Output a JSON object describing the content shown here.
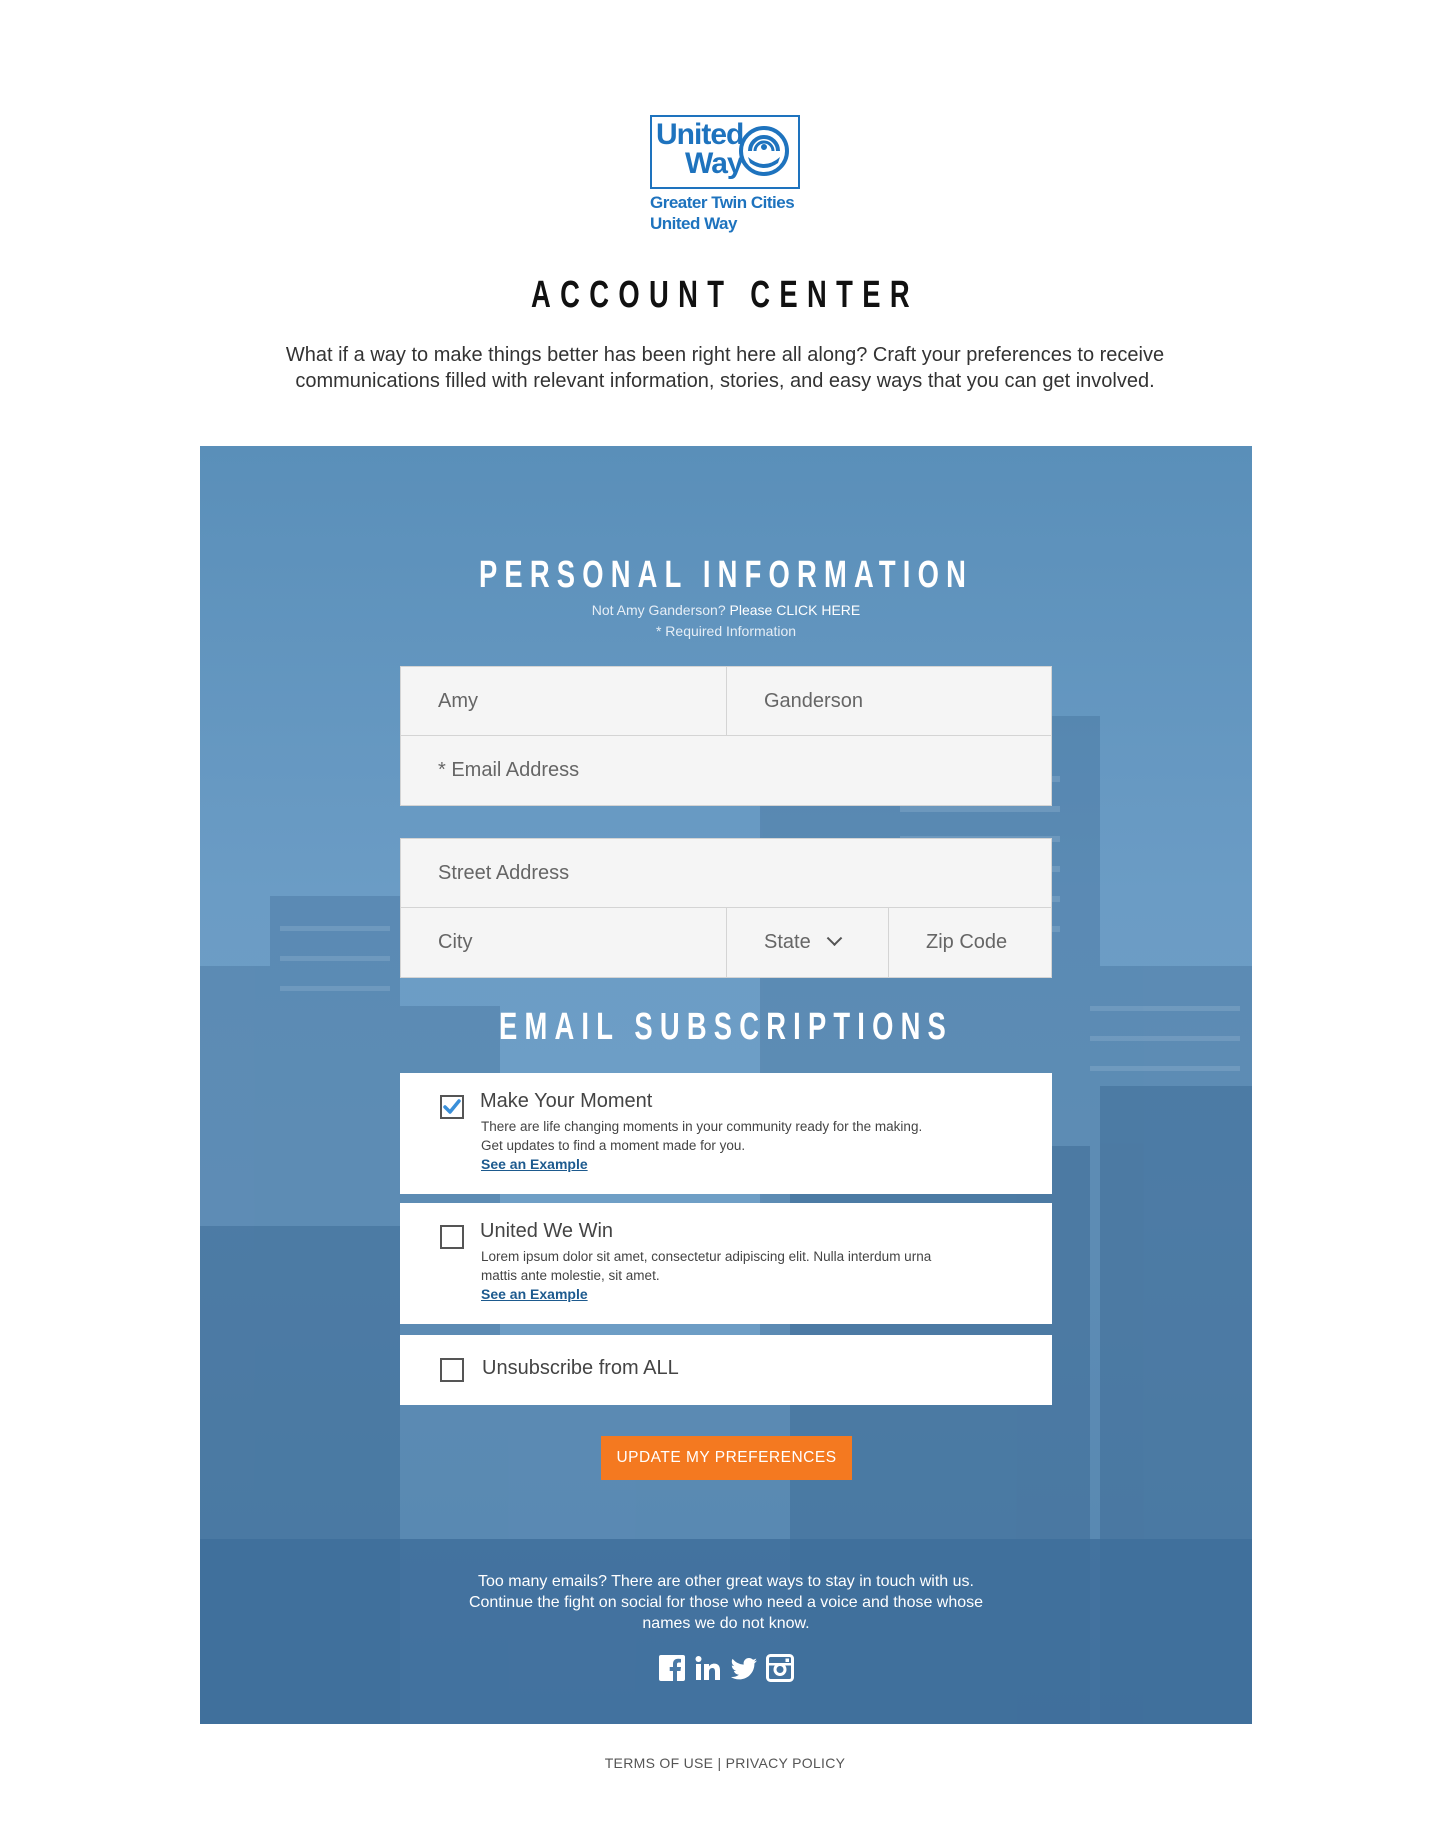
{
  "brand": {
    "logo_line1": "United",
    "logo_line2": "Way",
    "logo_sub1": "Greater Twin Cities",
    "logo_sub2": "United Way",
    "color": "#1e73be"
  },
  "header": {
    "title": "ACCOUNT CENTER",
    "intro": "What if a way to make things better has been right here all along? Craft your preferences to receive communications filled with relevant information, stories, and easy ways that you can get involved."
  },
  "personal": {
    "title": "PERSONAL INFORMATION",
    "not_user_prefix": "Not Amy Ganderson?",
    "not_user_link": "Please CLICK HERE",
    "required_note": "* Required Information",
    "first_name": "Amy",
    "last_name": "Ganderson",
    "email_placeholder": "* Email Address",
    "street_placeholder": "Street Address",
    "city_placeholder": "City",
    "state_label": "State",
    "zip_placeholder": "Zip Code"
  },
  "subscriptions": {
    "title": "EMAIL SUBSCRIPTIONS",
    "items": [
      {
        "name": "Make Your Moment",
        "desc_line1": "There are life changing moments in your community ready for the making.",
        "desc_line2": "Get updates to find a moment made for you.",
        "link": "See an Example",
        "checked": true
      },
      {
        "name": "United We Win",
        "desc_line1": "Lorem ipsum dolor sit amet, consectetur adipiscing elit. Nulla interdum urna",
        "desc_line2": "mattis ante molestie, sit amet.",
        "link": "See an Example",
        "checked": false
      }
    ],
    "unsubscribe_label": "Unsubscribe from ALL",
    "unsubscribe_checked": false
  },
  "actions": {
    "update_label": "UPDATE MY PREFERENCES",
    "accent": "#f47920"
  },
  "footer": {
    "line1": "Too many emails? There are other great ways to stay in touch with us.",
    "line2": "Continue the fight on social for those who need a voice and those whose",
    "line3": "names we do not know.",
    "social": [
      "facebook-icon",
      "linkedin-icon",
      "twitter-icon",
      "instagram-icon"
    ],
    "terms": "TERMS OF USE",
    "separator": "|",
    "privacy": "PRIVACY POLICY"
  }
}
